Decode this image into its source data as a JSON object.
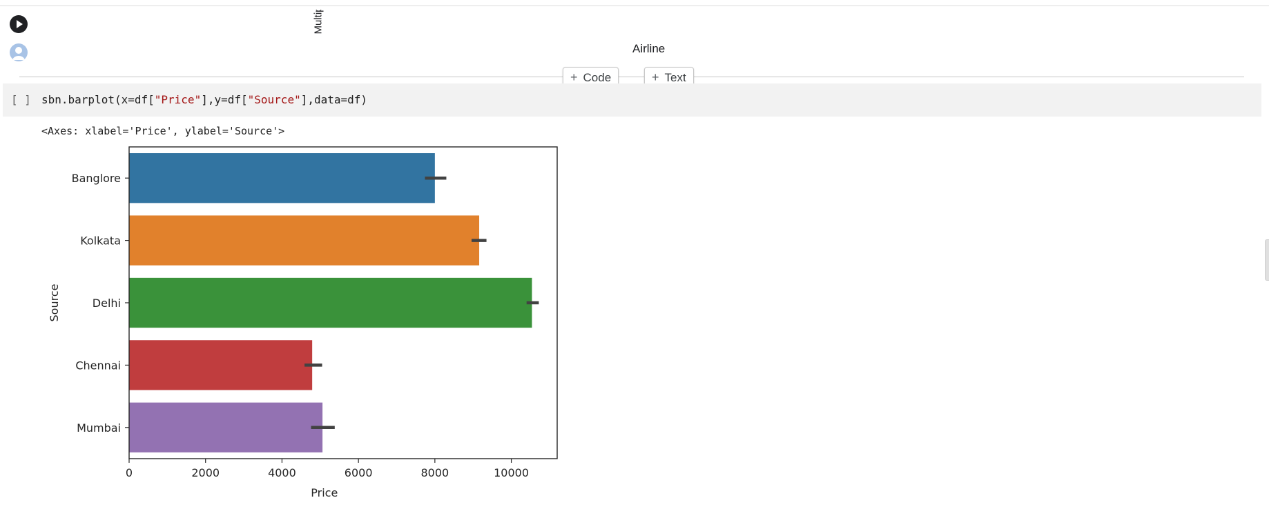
{
  "previous_output": {
    "rotated_label_fragment": "Multip",
    "xlabel": "Airline"
  },
  "toolbar": {
    "add_code_label": "Code",
    "add_text_label": "Text"
  },
  "cell": {
    "bracket": "[ ]",
    "code_parts": [
      "sbn.barplot(x=df[",
      "\"Price\"",
      "],y=df[",
      "\"Source\"",
      "],data=df)"
    ]
  },
  "output": {
    "repr_text": "<Axes: xlabel='Price', ylabel='Source'>"
  },
  "colors": {
    "run_button": "#202124",
    "cell_background": "#f2f2f2",
    "string_literal": "#a31515"
  },
  "icons": {
    "run": "play-circle-icon",
    "avatar": "user-avatar-icon",
    "add": "plus-icon"
  },
  "chart_data": {
    "type": "bar",
    "orientation": "horizontal",
    "categories": [
      "Banglore",
      "Kolkata",
      "Delhi",
      "Chennai",
      "Mumbai"
    ],
    "values": [
      8000,
      9160,
      10540,
      4790,
      5060
    ],
    "ci": [
      [
        7740,
        8300
      ],
      [
        8960,
        9350
      ],
      [
        10400,
        10720
      ],
      [
        4590,
        5050
      ],
      [
        4760,
        5380
      ]
    ],
    "colors": [
      "#3274a1",
      "#e1812c",
      "#3a923a",
      "#c03d3e",
      "#9372b2"
    ],
    "xlabel": "Price",
    "ylabel": "Source",
    "xlim": [
      0,
      11200
    ],
    "xticks": [
      0,
      2000,
      4000,
      6000,
      8000,
      10000
    ],
    "grid": false
  }
}
